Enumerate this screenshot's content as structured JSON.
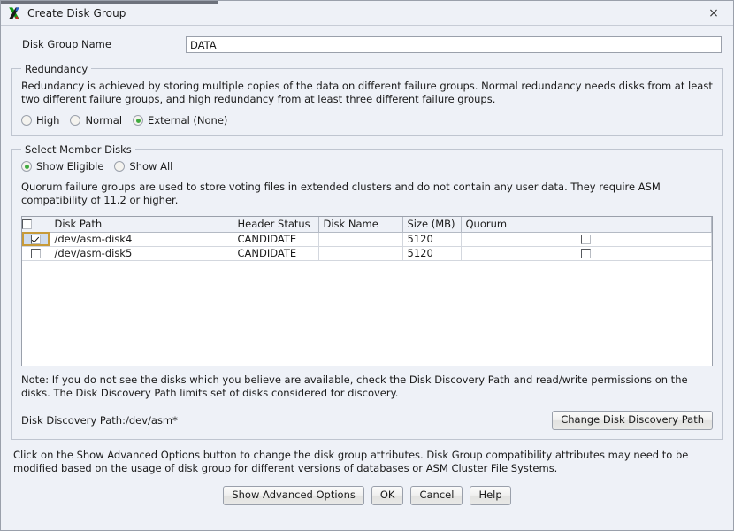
{
  "window": {
    "title": "Create Disk Group",
    "icon": "xming-x-icon",
    "close_label": "×"
  },
  "disk_group_name": {
    "label": "Disk Group Name",
    "value": "DATA",
    "placeholder": ""
  },
  "redundancy": {
    "legend": "Redundancy",
    "description": "Redundancy is achieved by storing multiple copies of the data on different failure groups. Normal redundancy needs disks from at least two different failure groups, and high redundancy from at least three different failure groups.",
    "options": [
      {
        "label": "High",
        "selected": false
      },
      {
        "label": "Normal",
        "selected": false
      },
      {
        "label": "External (None)",
        "selected": true
      }
    ]
  },
  "member_disks": {
    "legend": "Select Member Disks",
    "filter_options": [
      {
        "label": "Show Eligible",
        "selected": true
      },
      {
        "label": "Show All",
        "selected": false
      }
    ],
    "quorum_note": "Quorum failure groups are used to store voting files in extended clusters and do not contain any user data. They require ASM compatibility of 11.2 or higher.",
    "table": {
      "select_all_checked": false,
      "columns": [
        "",
        "Disk Path",
        "Header Status",
        "Disk Name",
        "Size (MB)",
        "Quorum"
      ],
      "rows": [
        {
          "selected": true,
          "focused": true,
          "disk_path": "/dev/asm-disk4",
          "header_status": "CANDIDATE",
          "disk_name": "",
          "size_mb": "5120",
          "quorum": false
        },
        {
          "selected": false,
          "focused": false,
          "disk_path": "/dev/asm-disk5",
          "header_status": "CANDIDATE",
          "disk_name": "",
          "size_mb": "5120",
          "quorum": false
        }
      ]
    },
    "note": "Note: If you do not see the disks which you believe are available, check the Disk Discovery Path and read/write permissions on the disks. The Disk Discovery Path limits set of disks considered for discovery.",
    "discovery_path_text": "Disk Discovery Path:/dev/asm*",
    "change_path_button": "Change Disk Discovery Path"
  },
  "footer": {
    "text": "Click on the Show Advanced Options button to change the disk group attributes. Disk Group compatibility attributes may need to be modified based on the usage of disk group for different versions of databases or ASM Cluster File Systems.",
    "buttons": [
      {
        "label": "Show Advanced Options"
      },
      {
        "label": "OK"
      },
      {
        "label": "Cancel"
      },
      {
        "label": "Help"
      }
    ]
  },
  "colors": {
    "dialog_bg": "#eef1f7",
    "radio_selected": "#3faa3f",
    "row_focus_border": "#c79a38",
    "row_selected_bg": "#cfdcee"
  }
}
